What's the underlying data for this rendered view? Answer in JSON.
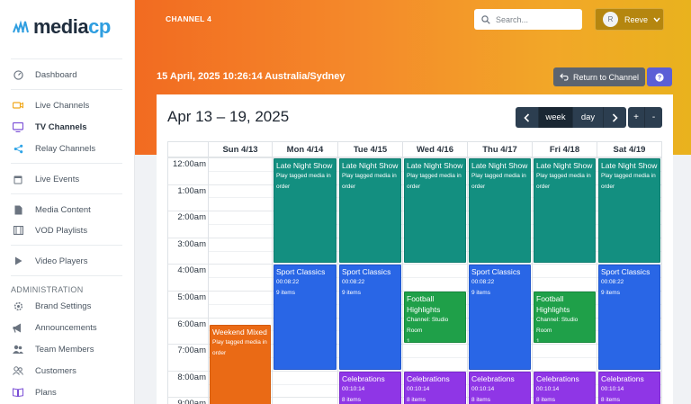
{
  "brand": {
    "name_main": "media",
    "name_accent": "cp"
  },
  "sidebar": {
    "items": [
      {
        "label": "Dashboard",
        "icon": "gauge-icon"
      },
      {
        "label": "Live Channels",
        "icon": "camera-icon"
      },
      {
        "label": "TV Channels",
        "icon": "tv-icon",
        "active": true
      },
      {
        "label": "Relay Channels",
        "icon": "share-icon"
      },
      {
        "label": "Live Events",
        "icon": "calendar-icon"
      },
      {
        "label": "Media Content",
        "icon": "file-icon"
      },
      {
        "label": "VOD Playlists",
        "icon": "film-icon"
      },
      {
        "label": "Video Players",
        "icon": "play-icon"
      }
    ],
    "section_admin": "ADMINISTRATION",
    "admin_items": [
      {
        "label": "Brand Settings",
        "icon": "gear-icon"
      },
      {
        "label": "Announcements",
        "icon": "megaphone-icon"
      },
      {
        "label": "Team Members",
        "icon": "users-icon"
      },
      {
        "label": "Customers",
        "icon": "user-group-icon"
      },
      {
        "label": "Plans",
        "icon": "book-icon"
      }
    ]
  },
  "header": {
    "channel": "CHANNEL 4",
    "search_placeholder": "Search...",
    "user_initial": "R",
    "user_name": "Reeve",
    "datetime": "15 April, 2025 10:26:14 Australia/Sydney",
    "return_label": "Return to Channel",
    "help_label": "?"
  },
  "calendar": {
    "title": "Apr 13 – 19, 2025",
    "prev": "‹",
    "next": "›",
    "view_week": "week",
    "view_day": "day",
    "zoom_in": "+",
    "zoom_out": "-",
    "days": [
      "Sun 4/13",
      "Mon 4/14",
      "Tue 4/15",
      "Wed 4/16",
      "Thu 4/17",
      "Fri 4/18",
      "Sat 4/19"
    ],
    "times": [
      "12:00am",
      "1:00am",
      "2:00am",
      "3:00am",
      "4:00am",
      "5:00am",
      "6:00am",
      "7:00am",
      "8:00am",
      "9:00am"
    ],
    "events": [
      {
        "day": 1,
        "start": 0,
        "end": 4,
        "color": "teal",
        "title": "Late Night Show",
        "line1": "Play tagged media in",
        "line2": "order"
      },
      {
        "day": 2,
        "start": 0,
        "end": 4,
        "color": "teal",
        "title": "Late Night Show",
        "line1": "Play tagged media in",
        "line2": "order"
      },
      {
        "day": 3,
        "start": 0,
        "end": 4,
        "color": "teal",
        "title": "Late Night Show",
        "line1": "Play tagged media in",
        "line2": "order"
      },
      {
        "day": 4,
        "start": 0,
        "end": 4,
        "color": "teal",
        "title": "Late Night Show",
        "line1": "Play tagged media in",
        "line2": "order"
      },
      {
        "day": 5,
        "start": 0,
        "end": 4,
        "color": "teal",
        "title": "Late Night Show",
        "line1": "Play tagged media in",
        "line2": "order"
      },
      {
        "day": 6,
        "start": 0,
        "end": 4,
        "color": "teal",
        "title": "Late Night Show",
        "line1": "Play tagged media in",
        "line2": "order"
      },
      {
        "day": 1,
        "start": 4,
        "end": 8,
        "color": "blue",
        "title": "Sport Classics",
        "line1": "00:08:22",
        "line2": "9 items"
      },
      {
        "day": 2,
        "start": 4,
        "end": 8,
        "color": "blue",
        "title": "Sport Classics",
        "line1": "00:08:22",
        "line2": "9 items"
      },
      {
        "day": 4,
        "start": 4,
        "end": 8,
        "color": "blue",
        "title": "Sport Classics",
        "line1": "00:08:22",
        "line2": "9 items"
      },
      {
        "day": 6,
        "start": 4,
        "end": 8,
        "color": "blue",
        "title": "Sport Classics",
        "line1": "00:08:22",
        "line2": "9 items"
      },
      {
        "day": 3,
        "start": 5,
        "end": 7,
        "color": "green",
        "title": "Football Highlights",
        "line1": "Channel: Studio Room",
        "line2": "1"
      },
      {
        "day": 5,
        "start": 5,
        "end": 7,
        "color": "green",
        "title": "Football Highlights",
        "line1": "Channel: Studio Room",
        "line2": "1"
      },
      {
        "day": 0,
        "start": 6.25,
        "end": 10,
        "color": "orange",
        "title": "Weekend Mixed",
        "line1": "Play tagged media in",
        "line2": "order"
      },
      {
        "day": 2,
        "start": 8,
        "end": 10,
        "color": "purple",
        "title": "Celebrations",
        "line1": "00:10:14",
        "line2": "8 items"
      },
      {
        "day": 3,
        "start": 8,
        "end": 10,
        "color": "purple",
        "title": "Celebrations",
        "line1": "00:10:14",
        "line2": "8 items"
      },
      {
        "day": 4,
        "start": 8,
        "end": 10,
        "color": "purple",
        "title": "Celebrations",
        "line1": "00:10:14",
        "line2": "8 items"
      },
      {
        "day": 5,
        "start": 8,
        "end": 10,
        "color": "purple",
        "title": "Celebrations",
        "line1": "00:10:14",
        "line2": "8 items"
      },
      {
        "day": 6,
        "start": 8,
        "end": 10,
        "color": "purple",
        "title": "Celebrations",
        "line1": "00:10:14",
        "line2": "8 items"
      }
    ]
  },
  "colors": {
    "accent": "#f26b21",
    "brand_blue": "#2f9ee0",
    "nav_dark": "#2c3e50"
  }
}
